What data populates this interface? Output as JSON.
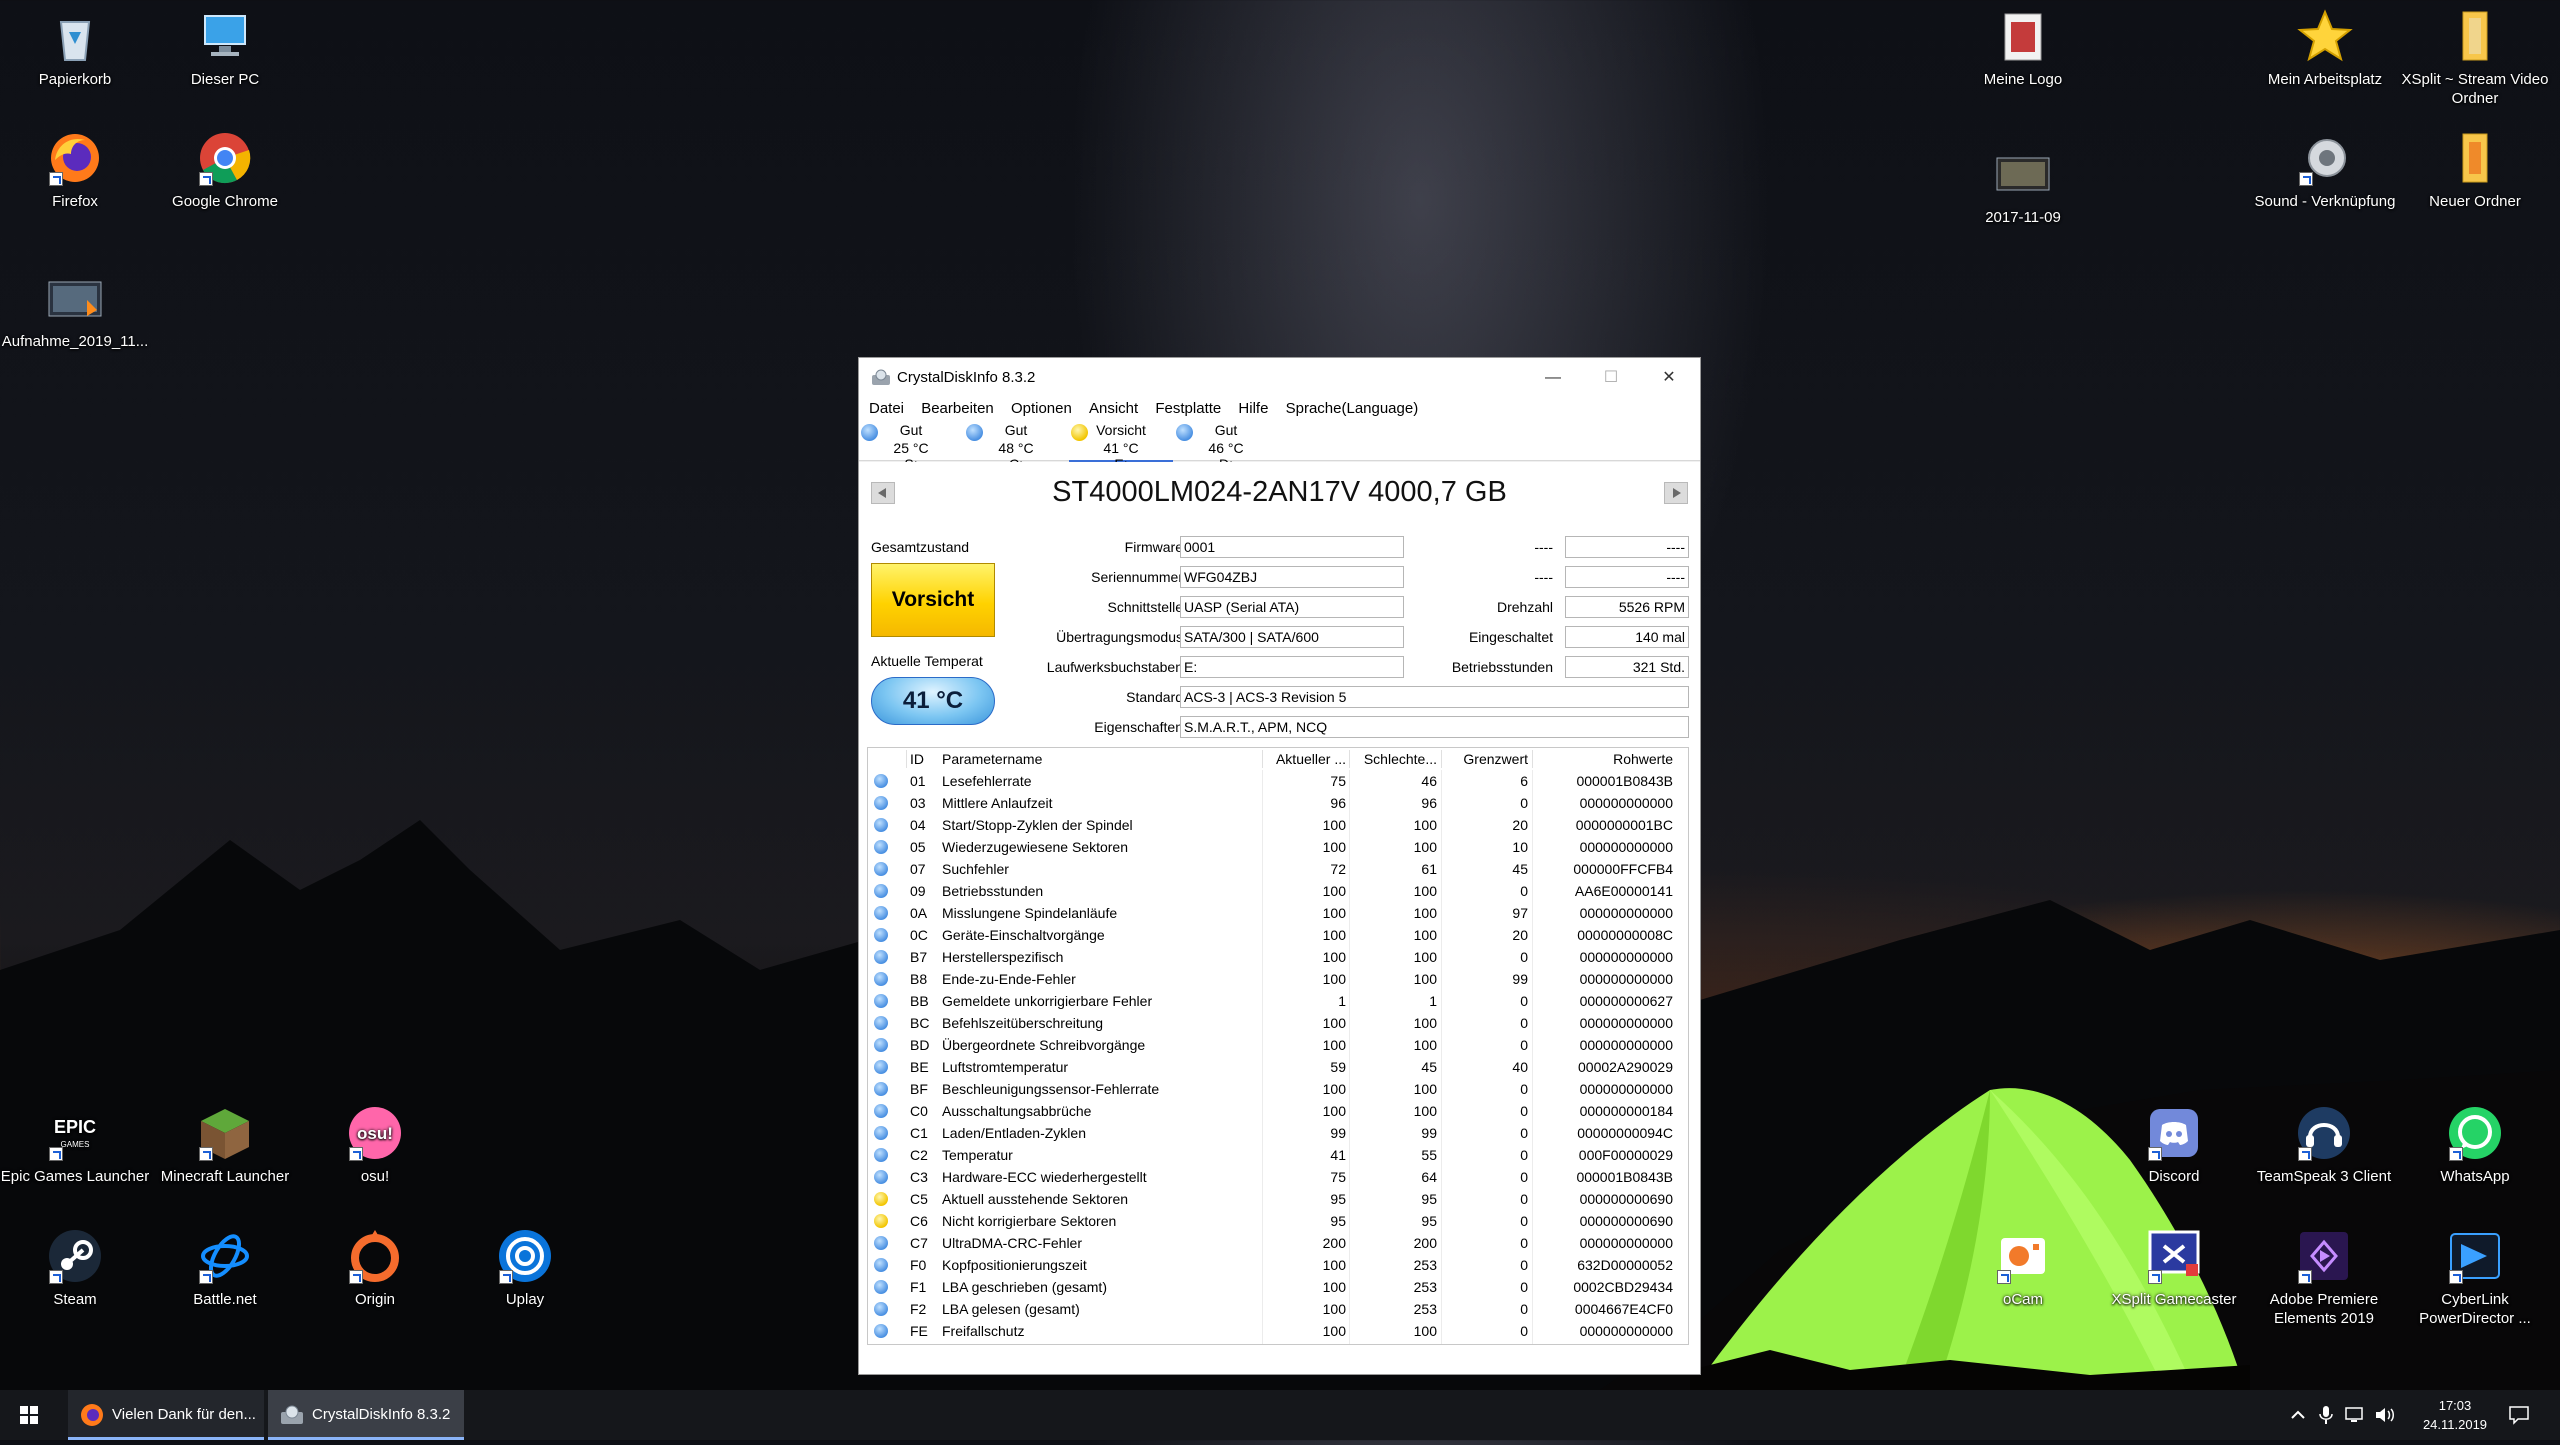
{
  "desktop": {
    "icons": [
      {
        "id": "recycle",
        "label": "Papierkorb"
      },
      {
        "id": "pc",
        "label": "Dieser PC"
      },
      {
        "id": "firefox",
        "label": "Firefox"
      },
      {
        "id": "chrome",
        "label": "Google Chrome"
      },
      {
        "id": "rec",
        "label": "Aufnahme_2019_11..."
      },
      {
        "id": "logo",
        "label": "Meine Logo"
      },
      {
        "id": "workspace",
        "label": "Mein Arbeitsplatz"
      },
      {
        "id": "xsplit_folder",
        "label": "XSplit ~ Stream Video Ordner"
      },
      {
        "id": "date_file",
        "label": "2017-11-09"
      },
      {
        "id": "sound",
        "label": "Sound - Verknüpfung"
      },
      {
        "id": "newfolder",
        "label": "Neuer Ordner"
      },
      {
        "id": "epic",
        "label": "Epic Games Launcher"
      },
      {
        "id": "minecraft",
        "label": "Minecraft Launcher"
      },
      {
        "id": "osu",
        "label": "osu!"
      },
      {
        "id": "steam",
        "label": "Steam"
      },
      {
        "id": "battlenet",
        "label": "Battle.net"
      },
      {
        "id": "origin",
        "label": "Origin"
      },
      {
        "id": "uplay",
        "label": "Uplay"
      },
      {
        "id": "discord",
        "label": "Discord"
      },
      {
        "id": "teamspeak",
        "label": "TeamSpeak 3 Client"
      },
      {
        "id": "whatsapp",
        "label": "WhatsApp"
      },
      {
        "id": "ocam",
        "label": "oCam"
      },
      {
        "id": "xsplit_gc",
        "label": "XSplit Gamecaster"
      },
      {
        "id": "premiere",
        "label": "Adobe Premiere Elements 2019"
      },
      {
        "id": "cyberlink",
        "label": "CyberLink PowerDirector ..."
      }
    ]
  },
  "window": {
    "title": "CrystalDiskInfo 8.3.2",
    "minimize": "—",
    "maximize": "☐",
    "close": "✕",
    "menu": [
      "Datei",
      "Bearbeiten",
      "Optionen",
      "Ansicht",
      "Festplatte",
      "Hilfe",
      "Sprache(Language)"
    ],
    "drives": [
      {
        "status": "Gut",
        "temp": "25 °C",
        "letter": "S:",
        "color": "#4a90e2"
      },
      {
        "status": "Gut",
        "temp": "48 °C",
        "letter": "C:",
        "color": "#4a90e2"
      },
      {
        "status": "Vorsicht",
        "temp": "41 °C",
        "letter": "E:",
        "color": "#f2c500"
      },
      {
        "status": "Gut",
        "temp": "46 °C",
        "letter": "D:",
        "color": "#4a90e2"
      }
    ],
    "model": "ST4000LM024-2AN17V 4000,7 GB",
    "health_label": "Gesamtzustand",
    "health_value": "Vorsicht",
    "temp_label": "Aktuelle Temperat",
    "temp_value": "41 °C",
    "info": {
      "firmware_label": "Firmware",
      "firmware": "0001",
      "serial_label": "Seriennummer",
      "serial": "WFG04ZBJ",
      "interface_label": "Schnittstelle",
      "interface": "UASP (Serial ATA)",
      "transfer_label": "Übertragungsmodus",
      "transfer": "SATA/300 | SATA/600",
      "letters_label": "Laufwerksbuchstaben",
      "letters": "E:",
      "standard_label": "Standard",
      "standard": "ACS-3 | ACS-3 Revision 5",
      "features_label": "Eigenschaften",
      "features": "S.M.A.R.T., APM, NCQ",
      "r1_label": "----",
      "r1_value": "----",
      "r2_label": "----",
      "r2_value": "----",
      "rpm_label": "Drehzahl",
      "rpm": "5526 RPM",
      "power_on_count_label": "Eingeschaltet",
      "power_on_count": "140 mal",
      "hours_label": "Betriebsstunden",
      "hours": "321 Std."
    },
    "smart_headers": {
      "id": "ID",
      "name": "Parametername",
      "current": "Aktueller ...",
      "worst": "Schlechte...",
      "threshold": "Grenzwert",
      "raw": "Rohwerte"
    },
    "smart_rows": [
      {
        "dot": "blue",
        "id": "01",
        "name": "Lesefehlerrate",
        "cur": "75",
        "worst": "46",
        "thr": "6",
        "raw": "000001B0843B"
      },
      {
        "dot": "blue",
        "id": "03",
        "name": "Mittlere Anlaufzeit",
        "cur": "96",
        "worst": "96",
        "thr": "0",
        "raw": "000000000000"
      },
      {
        "dot": "blue",
        "id": "04",
        "name": "Start/Stopp-Zyklen der Spindel",
        "cur": "100",
        "worst": "100",
        "thr": "20",
        "raw": "0000000001BC"
      },
      {
        "dot": "blue",
        "id": "05",
        "name": "Wiederzugewiesene Sektoren",
        "cur": "100",
        "worst": "100",
        "thr": "10",
        "raw": "000000000000"
      },
      {
        "dot": "blue",
        "id": "07",
        "name": "Suchfehler",
        "cur": "72",
        "worst": "61",
        "thr": "45",
        "raw": "000000FFCFB4"
      },
      {
        "dot": "blue",
        "id": "09",
        "name": "Betriebsstunden",
        "cur": "100",
        "worst": "100",
        "thr": "0",
        "raw": "AA6E00000141"
      },
      {
        "dot": "blue",
        "id": "0A",
        "name": "Misslungene Spindelanläufe",
        "cur": "100",
        "worst": "100",
        "thr": "97",
        "raw": "000000000000"
      },
      {
        "dot": "blue",
        "id": "0C",
        "name": "Geräte-Einschaltvorgänge",
        "cur": "100",
        "worst": "100",
        "thr": "20",
        "raw": "00000000008C"
      },
      {
        "dot": "blue",
        "id": "B7",
        "name": "Herstellerspezifisch",
        "cur": "100",
        "worst": "100",
        "thr": "0",
        "raw": "000000000000"
      },
      {
        "dot": "blue",
        "id": "B8",
        "name": "Ende-zu-Ende-Fehler",
        "cur": "100",
        "worst": "100",
        "thr": "99",
        "raw": "000000000000"
      },
      {
        "dot": "blue",
        "id": "BB",
        "name": "Gemeldete unkorrigierbare Fehler",
        "cur": "1",
        "worst": "1",
        "thr": "0",
        "raw": "000000000627"
      },
      {
        "dot": "blue",
        "id": "BC",
        "name": "Befehlszeitüberschreitung",
        "cur": "100",
        "worst": "100",
        "thr": "0",
        "raw": "000000000000"
      },
      {
        "dot": "blue",
        "id": "BD",
        "name": "Übergeordnete Schreibvorgänge",
        "cur": "100",
        "worst": "100",
        "thr": "0",
        "raw": "000000000000"
      },
      {
        "dot": "blue",
        "id": "BE",
        "name": "Luftstromtemperatur",
        "cur": "59",
        "worst": "45",
        "thr": "40",
        "raw": "00002A290029"
      },
      {
        "dot": "blue",
        "id": "BF",
        "name": "Beschleunigungssensor-Fehlerrate",
        "cur": "100",
        "worst": "100",
        "thr": "0",
        "raw": "000000000000"
      },
      {
        "dot": "blue",
        "id": "C0",
        "name": "Ausschaltungsabbrüche",
        "cur": "100",
        "worst": "100",
        "thr": "0",
        "raw": "000000000184"
      },
      {
        "dot": "blue",
        "id": "C1",
        "name": "Laden/Entladen-Zyklen",
        "cur": "99",
        "worst": "99",
        "thr": "0",
        "raw": "00000000094C"
      },
      {
        "dot": "blue",
        "id": "C2",
        "name": "Temperatur",
        "cur": "41",
        "worst": "55",
        "thr": "0",
        "raw": "000F00000029"
      },
      {
        "dot": "blue",
        "id": "C3",
        "name": "Hardware-ECC wiederhergestellt",
        "cur": "75",
        "worst": "64",
        "thr": "0",
        "raw": "000001B0843B"
      },
      {
        "dot": "yellow",
        "id": "C5",
        "name": "Aktuell ausstehende Sektoren",
        "cur": "95",
        "worst": "95",
        "thr": "0",
        "raw": "000000000690"
      },
      {
        "dot": "yellow",
        "id": "C6",
        "name": "Nicht korrigierbare Sektoren",
        "cur": "95",
        "worst": "95",
        "thr": "0",
        "raw": "000000000690"
      },
      {
        "dot": "blue",
        "id": "C7",
        "name": "UltraDMA-CRC-Fehler",
        "cur": "200",
        "worst": "200",
        "thr": "0",
        "raw": "000000000000"
      },
      {
        "dot": "blue",
        "id": "F0",
        "name": "Kopfpositionierungszeit",
        "cur": "100",
        "worst": "253",
        "thr": "0",
        "raw": "632D00000052"
      },
      {
        "dot": "blue",
        "id": "F1",
        "name": "LBA geschrieben (gesamt)",
        "cur": "100",
        "worst": "253",
        "thr": "0",
        "raw": "0002CBD29434"
      },
      {
        "dot": "blue",
        "id": "F2",
        "name": "LBA gelesen (gesamt)",
        "cur": "100",
        "worst": "253",
        "thr": "0",
        "raw": "0004667E4CF0"
      },
      {
        "dot": "blue",
        "id": "FE",
        "name": "Freifallschutz",
        "cur": "100",
        "worst": "100",
        "thr": "0",
        "raw": "000000000000"
      }
    ]
  },
  "taskbar": {
    "tasks": [
      {
        "label": "Vielen Dank für den...",
        "icon": "firefox"
      },
      {
        "label": "CrystalDiskInfo 8.3.2",
        "icon": "crystaldiskinfo"
      }
    ],
    "time": "17:03",
    "date": "24.11.2019"
  },
  "colors": {
    "dot_blue": "#4a90e2",
    "dot_yellow": "#f2c500",
    "status_caution": "#ffd200",
    "taskbar": "#15171b"
  }
}
